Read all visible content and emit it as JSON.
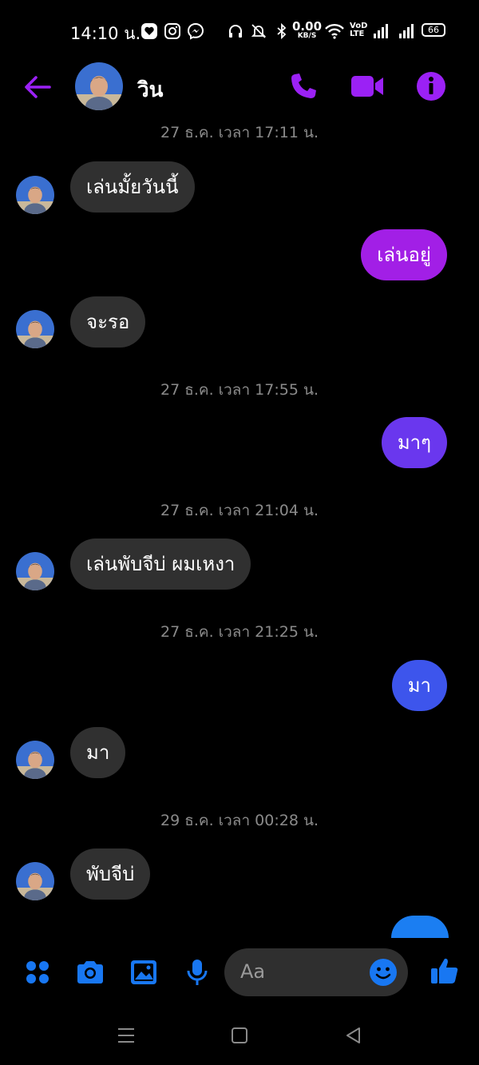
{
  "status_bar": {
    "time": "14:10 น.",
    "speed_value": "0.00",
    "speed_unit": "KB/S",
    "volte_top": "VoD",
    "volte_bottom": "LTE",
    "battery": "66"
  },
  "header": {
    "contact_name": "วิน",
    "accent": "#9b21f5"
  },
  "messages": [
    {
      "type": "timestamp",
      "text": "27 ธ.ค. เวลา 17:11 น."
    },
    {
      "type": "in",
      "text": "เล่นมั้ยวันนี้"
    },
    {
      "type": "out",
      "text": "เล่นอยู่",
      "color": "#a21fe6"
    },
    {
      "type": "in",
      "text": "จะรอ"
    },
    {
      "type": "timestamp",
      "text": "27 ธ.ค. เวลา 17:55 น."
    },
    {
      "type": "out",
      "text": "มาๆ",
      "color": "#6a37ee"
    },
    {
      "type": "timestamp",
      "text": "27 ธ.ค. เวลา 21:04 น."
    },
    {
      "type": "in",
      "text": "เล่นพับจีบ่ ผมเหงา"
    },
    {
      "type": "timestamp",
      "text": "27 ธ.ค. เวลา 21:25 น."
    },
    {
      "type": "out",
      "text": "มา",
      "color": "#3d55ec"
    },
    {
      "type": "in",
      "text": "มา"
    },
    {
      "type": "timestamp",
      "text": "29 ธ.ค. เวลา 00:28 น."
    },
    {
      "type": "in",
      "text": "พับจีบ่"
    }
  ],
  "composer": {
    "placeholder": "Aa",
    "icon_color": "#1877f2"
  },
  "colors": {
    "incoming_bubble": "#303030",
    "timestamp": "#8a8a8a",
    "partial_bubble": "#1b7ef2"
  }
}
